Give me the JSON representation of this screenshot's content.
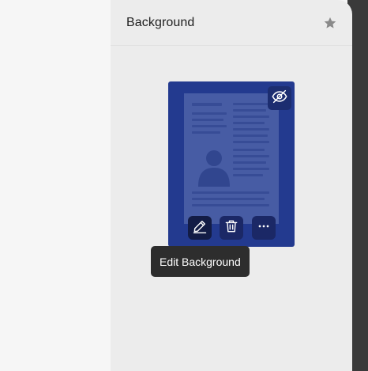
{
  "panel": {
    "title": "Background",
    "favorite_icon": "star-icon"
  },
  "background_item": {
    "visibility_icon": "eye-off-icon",
    "actions": [
      {
        "name": "edit",
        "icon": "pencil-icon"
      },
      {
        "name": "delete",
        "icon": "trash-icon"
      },
      {
        "name": "more",
        "icon": "ellipsis-icon"
      }
    ]
  },
  "tooltip": {
    "text": "Edit Background"
  },
  "colors": {
    "thumbnail_bg": "#233a8f",
    "tooltip_bg": "#2d2d2d",
    "panel_bg": "#ececec",
    "dark_strip": "#3a3a3a"
  }
}
